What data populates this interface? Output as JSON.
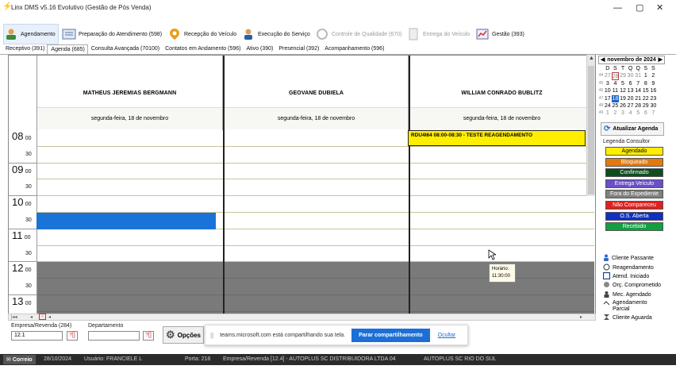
{
  "window": {
    "title": "Linx DMS v5.16 Evolutivo (Gestão de Pós Venda)",
    "controls": [
      "—",
      "▢",
      "✕"
    ]
  },
  "toolbar": [
    {
      "label": "Agendamento",
      "icon": "calendar-person-icon",
      "enabled": true,
      "active": true
    },
    {
      "label": "Preparação do Atendimento (598)",
      "icon": "clipboard-list-icon",
      "enabled": true
    },
    {
      "label": "Recepção do Veículo",
      "icon": "map-pin-icon",
      "enabled": true
    },
    {
      "label": "Execução do Serviço",
      "icon": "mechanic-icon",
      "enabled": true
    },
    {
      "label": "Controle de Qualidade (670)",
      "icon": "quality-icon",
      "enabled": false
    },
    {
      "label": "Entrega do Veículo",
      "icon": "document-icon",
      "enabled": false
    },
    {
      "label": "Gestão (393)",
      "icon": "chart-icon",
      "enabled": true
    }
  ],
  "tabs": [
    {
      "label": "Receptivo (391)"
    },
    {
      "label": "Agenda (685)",
      "active": true
    },
    {
      "label": "Consulta Avançada (70100)"
    },
    {
      "label": "Contatos em Andamento (596)"
    },
    {
      "label": "Ativo (390)"
    },
    {
      "label": "Presencial (392)"
    },
    {
      "label": "Acompanhamento (596)"
    }
  ],
  "schedule": {
    "hours": [
      {
        "hour": "08",
        "m1": "00",
        "m2": "30"
      },
      {
        "hour": "09",
        "m1": "00",
        "m2": "30"
      },
      {
        "hour": "10",
        "m1": "00",
        "m2": "30"
      },
      {
        "hour": "11",
        "m1": "00",
        "m2": "30"
      },
      {
        "hour": "12",
        "m1": "00",
        "m2": "30"
      },
      {
        "hour": "13",
        "m1": "00",
        "m2": "30"
      }
    ],
    "consultants": [
      {
        "name": "MATHEUS JEREMIAS BERGMANN",
        "date": "segunda-feira, 18 de novembro"
      },
      {
        "name": "GEOVANE DUBIELA",
        "date": "segunda-feira, 18 de novembro"
      },
      {
        "name": "WILLIAM CONRADO BUBLITZ",
        "date": "segunda-feira, 18 de novembro"
      }
    ],
    "appointment": {
      "text": "RDU4I64 08:00-08:30 - TESTE REAGENDAMENTO",
      "color": "#ffee00"
    },
    "tooltip": {
      "label": "Horário:",
      "value": "11:30:00"
    }
  },
  "calendar": {
    "month": "novembro de 2024",
    "weekdays": [
      "D",
      "S",
      "T",
      "Q",
      "Q",
      "S",
      "S"
    ],
    "weeks": [
      {
        "wk": "44",
        "days": [
          "27",
          "28",
          "29",
          "30",
          "31",
          "1",
          "2"
        ]
      },
      {
        "wk": "45",
        "days": [
          "3",
          "4",
          "5",
          "6",
          "7",
          "8",
          "9"
        ]
      },
      {
        "wk": "46",
        "days": [
          "10",
          "11",
          "12",
          "13",
          "14",
          "15",
          "16"
        ]
      },
      {
        "wk": "47",
        "days": [
          "17",
          "18",
          "19",
          "20",
          "21",
          "22",
          "23"
        ]
      },
      {
        "wk": "48",
        "days": [
          "24",
          "25",
          "26",
          "27",
          "28",
          "29",
          "30"
        ]
      },
      {
        "wk": "49",
        "days": [
          "1",
          "2",
          "3",
          "4",
          "5",
          "6",
          "7"
        ]
      }
    ],
    "selected": "18"
  },
  "side": {
    "update_button": "Atualizar Agenda",
    "legend_title": "Legenda Consultor",
    "legend": [
      {
        "label": "Agendado",
        "bg": "#ffee00",
        "fg": "#000"
      },
      {
        "label": "Bloqueado",
        "bg": "#e07a10",
        "fg": "#fff"
      },
      {
        "label": "Confirmado",
        "bg": "#0f4d20",
        "fg": "#fff"
      },
      {
        "label": "Entrega Veículo",
        "bg": "#6a4fc8",
        "fg": "#fff"
      },
      {
        "label": "Fora do Expediente",
        "bg": "#808080",
        "fg": "#fff"
      },
      {
        "label": "Não Compareceu",
        "bg": "#e02020",
        "fg": "#fff"
      },
      {
        "label": "O.S. Aberta",
        "bg": "#1030c0",
        "fg": "#fff"
      },
      {
        "label": "Recebido",
        "bg": "#10a040",
        "fg": "#fff"
      }
    ],
    "status": [
      {
        "label": "Cliente Passante",
        "icon": "person-icon"
      },
      {
        "label": "Reagendamento",
        "icon": "reschedule-icon"
      },
      {
        "label": "Atend. Iniciado",
        "icon": "checkbox-icon"
      },
      {
        "label": "Orç. Comprometido",
        "icon": "budget-icon"
      },
      {
        "label": "Mec. Agendado",
        "icon": "mechanic-icon"
      },
      {
        "label": "Agendamento Parcial",
        "icon": "partial-icon"
      },
      {
        "label": "Cliente Aguarda",
        "icon": "hourglass-icon"
      }
    ]
  },
  "filters": {
    "empresa_label": "Empresa/Revenda (284)",
    "empresa_value": "12.1",
    "departamento_label": "Departamento",
    "departamento_value": "",
    "options_label": "Opções"
  },
  "share_bar": {
    "grip": "||",
    "text": "teams.microsoft.com está compartilhando sua tela.",
    "stop": "Parar compartilhamento",
    "hide": "Ocultar"
  },
  "statusbar": {
    "mail": "Correio",
    "date": "28/10/2024",
    "user": "Usuário: FRANCIELE L",
    "port": "Porta: 218",
    "company": "Empresa/Revenda [12.4] - AUTOPLUS SC DISTRIBUIDORA LTDA 04",
    "branch": "AUTOPLUS SC RIO DO SUL"
  }
}
